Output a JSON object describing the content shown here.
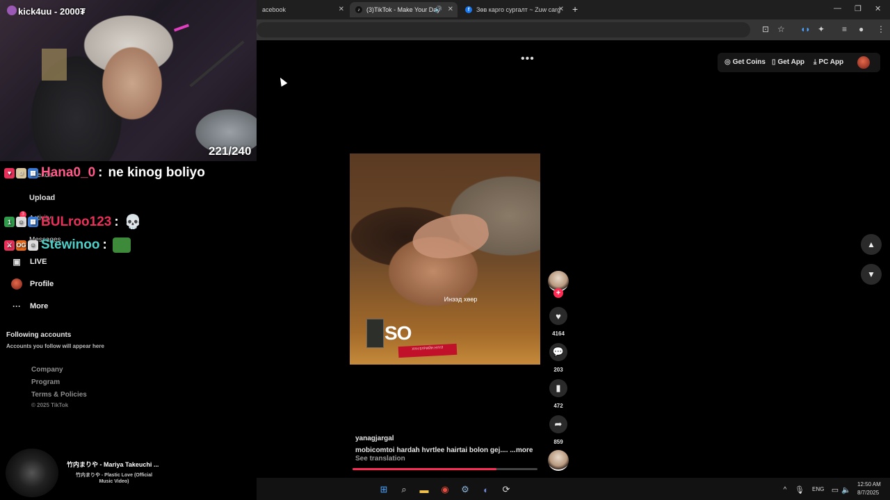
{
  "browser": {
    "tabs": [
      {
        "label": "acebook"
      },
      {
        "label": "(3)TikTok - Make Your Day"
      },
      {
        "label": "Зөв карго сургалт ~ Zuw carg"
      }
    ]
  },
  "tiktok": {
    "top_links": {
      "get_coins": "Get Coins",
      "get_app": "Get App",
      "pc_app": "PC App"
    },
    "sidebar": {
      "friends": "Friends",
      "upload": "Upload",
      "activity": "Activity",
      "messages": "Messages",
      "live": "LIVE",
      "profile": "Profile",
      "more": "More",
      "activity_badge": "3"
    },
    "following": {
      "title": "Following accounts",
      "subtitle": "Accounts you follow will appear here"
    },
    "footer": {
      "company": "Company",
      "program": "Program",
      "terms": "Terms & Policies",
      "copyright": "© 2025 TikTok"
    },
    "video": {
      "overlay_caption": "Инээд хөөр",
      "logo_text": "SO",
      "banner_text": "ХҮН БҮРИЙН НҮҮЛ",
      "author": "yanagjargal",
      "description": "mobicomtoi hardah hvrtlee hairtai bolon gej.... ...",
      "more": "more",
      "see_translation": "See translation",
      "progress": 0.78
    },
    "actions": {
      "likes": "4164",
      "comments": "203",
      "saves": "472",
      "shares": "859"
    }
  },
  "stream": {
    "kick_label": "kick4uu - 2000₮",
    "counter": "221/240",
    "chat": [
      {
        "user": "Hana0_0",
        "message": "ne kinog boliyo",
        "color": "#ff5a8a"
      },
      {
        "user": "BULroo123",
        "message": "",
        "color": "#e8305a"
      },
      {
        "user": "Stewinoo",
        "message": "",
        "color": "#4fd0c8"
      }
    ],
    "music": {
      "title": "竹内まりや - Mariya Takeuchi ...",
      "subtitle": "竹内まりや - Plastic Love (Official Music Video)"
    }
  },
  "system": {
    "lang": "ENG",
    "time": "12:50 AM",
    "date": "8/7/2025"
  },
  "colors": {
    "accent": "#fe2c55",
    "background": "#000000"
  }
}
